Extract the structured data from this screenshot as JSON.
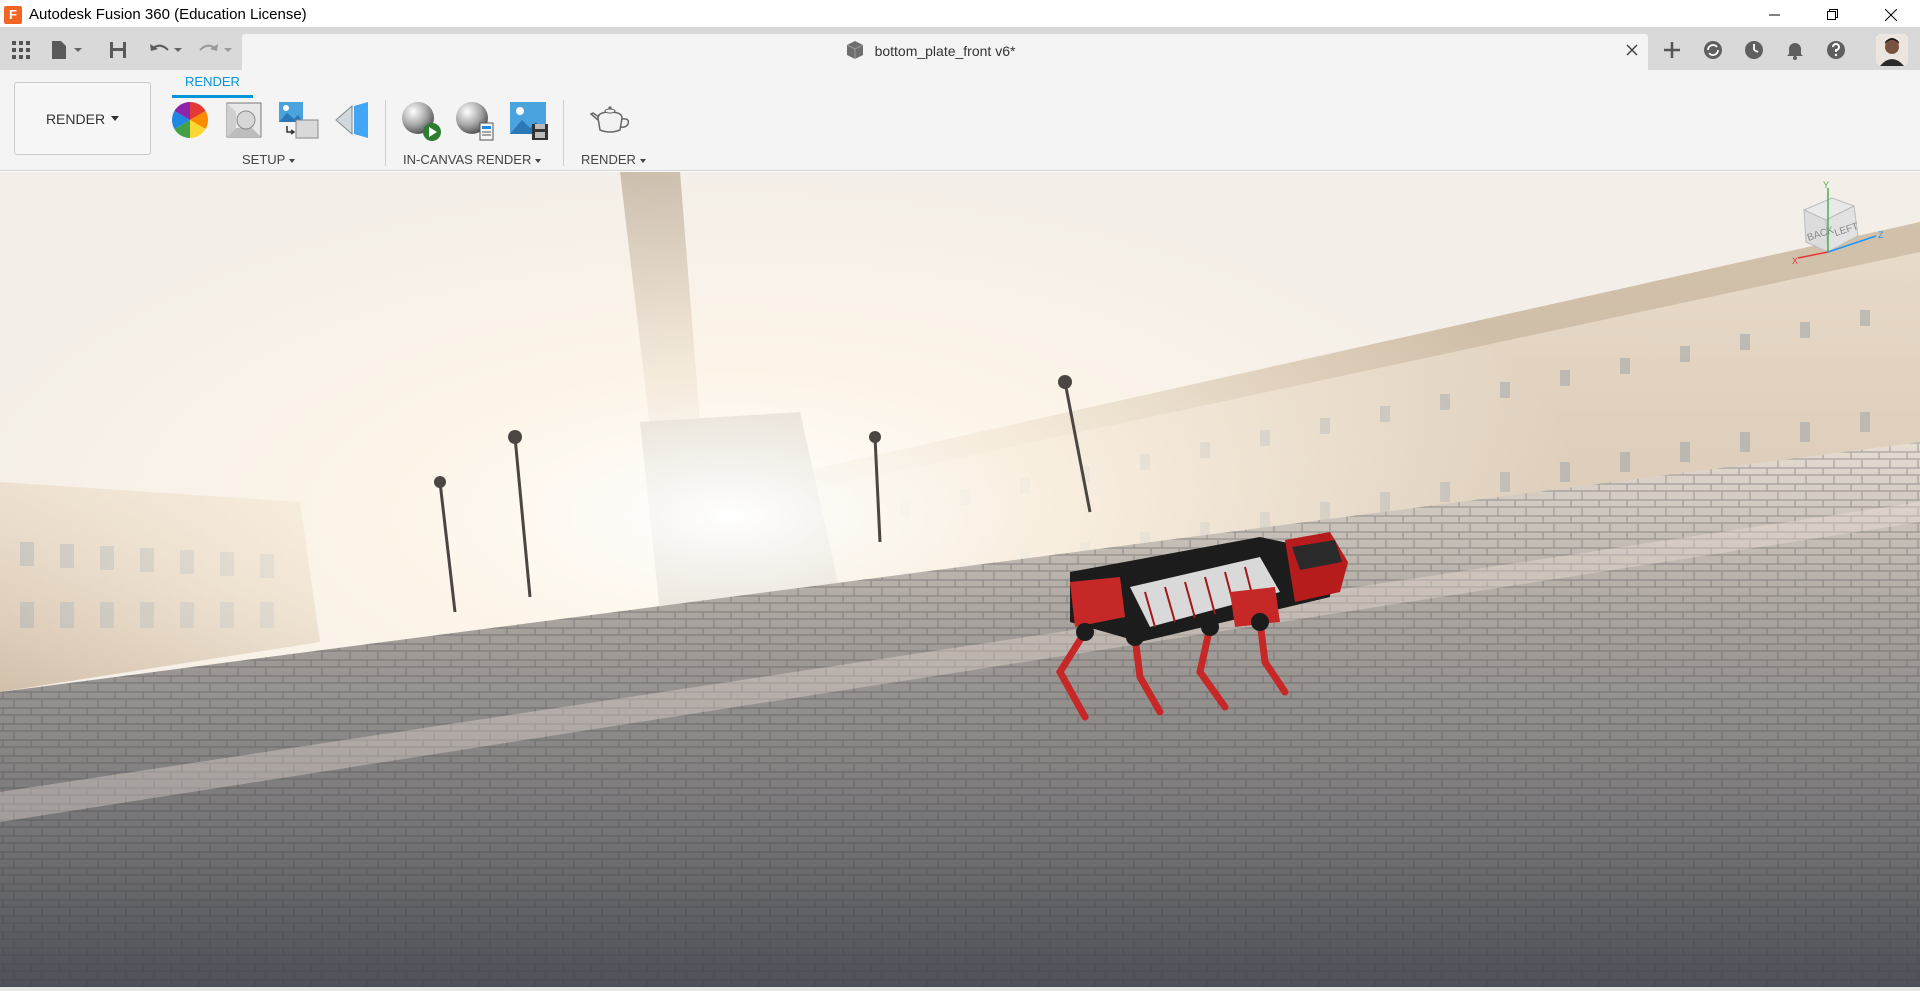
{
  "window": {
    "title": "Autodesk Fusion 360 (Education License)",
    "app_icon_letter": "F"
  },
  "document_tab": {
    "name": "bottom_plate_front v6*"
  },
  "toolbar": {
    "workspace": "RENDER",
    "active_tab": "RENDER",
    "groups": {
      "setup": "SETUP",
      "in_canvas_render": "IN-CANVAS RENDER",
      "render": "RENDER"
    }
  },
  "viewcube": {
    "faces": [
      "BACK",
      "LEFT"
    ],
    "axes": [
      "X",
      "Y",
      "Z"
    ]
  },
  "colors": {
    "accent": "#0696d7",
    "app_icon": "#f26522"
  }
}
